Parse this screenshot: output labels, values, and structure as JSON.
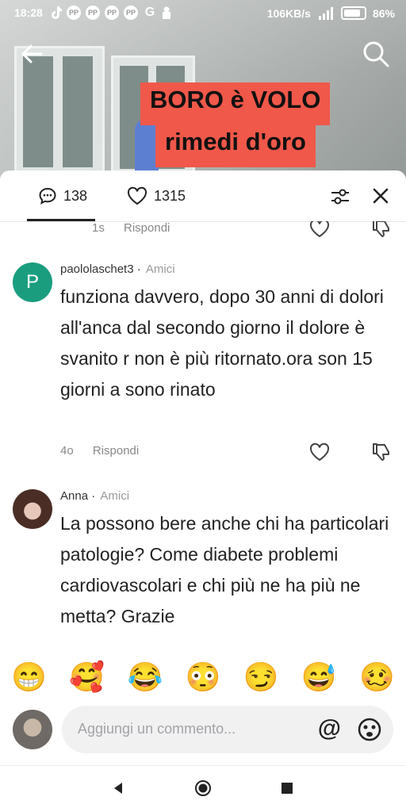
{
  "status_bar": {
    "time": "18:28",
    "network_speed": "106KB/s",
    "battery": "86%"
  },
  "video": {
    "overlay_line1": "BORO è VOLO",
    "overlay_line2": "rimedi d'oro"
  },
  "tabs": {
    "comments_count": "138",
    "likes_count": "1315"
  },
  "previous_comment_meta": {
    "time": "1s",
    "reply_label": "Rispondi"
  },
  "comments": [
    {
      "avatar_letter": "P",
      "username": "paololaschet3",
      "badge": "Amici",
      "text": "funziona davvero, dopo 30 anni di dolori all'anca dal secondo giorno il dolore è svanito r non è più ritornato.ora son 15 giorni a sono rinato",
      "time": "4o",
      "reply_label": "Rispondi"
    },
    {
      "username": "Anna",
      "badge": "Amici",
      "text": "La possono bere anche chi ha particolari patologie? Come diabete problemi cardiovascolari e chi più ne ha più ne metta? Grazie"
    }
  ],
  "emoji_bar": [
    "😁",
    "🥰",
    "😂",
    "😳",
    "😏",
    "😅",
    "🥴"
  ],
  "comment_input": {
    "placeholder": "Aggiungi un commento..."
  },
  "colors": {
    "accent_overlay": "#f0584a",
    "avatar_p": "#1a9d7f"
  }
}
